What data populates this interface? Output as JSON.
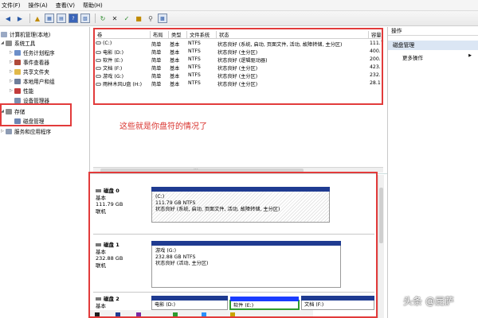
{
  "menu": {
    "file": "文件(F)",
    "action": "操作(A)",
    "view": "查看(V)",
    "help": "帮助(H)"
  },
  "tree": {
    "root": "计算机管理(本地)",
    "system_tools": "系统工具",
    "task_scheduler": "任务计划程序",
    "event_viewer": "事件查看器",
    "shared_folders": "共享文件夹",
    "local_users": "本地用户和组",
    "performance": "性能",
    "device_manager": "设备管理器",
    "storage": "存储",
    "disk_management": "磁盘管理",
    "services": "服务和应用程序"
  },
  "table": {
    "headers": {
      "volume": "卷",
      "layout": "布局",
      "type": "类型",
      "fs": "文件系统",
      "status": "状态",
      "capacity": "容量"
    },
    "rows": [
      {
        "volume": "(C:)",
        "layout": "简单",
        "type": "基本",
        "fs": "NTFS",
        "status": "状态良好 (系统, 启动, 页面文件, 活动, 故障转储, 主分区)",
        "capacity": "111.7"
      },
      {
        "volume": "电影 (D:)",
        "layout": "简单",
        "type": "基本",
        "fs": "NTFS",
        "status": "状态良好 (主分区)",
        "capacity": "400."
      },
      {
        "volume": "软件 (E:)",
        "layout": "简单",
        "type": "基本",
        "fs": "NTFS",
        "status": "状态良好 (逻辑驱动器)",
        "capacity": "200."
      },
      {
        "volume": "文档 (F:)",
        "layout": "简单",
        "type": "基本",
        "fs": "NTFS",
        "status": "状态良好 (主分区)",
        "capacity": "423."
      },
      {
        "volume": "游戏 (G:)",
        "layout": "简单",
        "type": "基本",
        "fs": "NTFS",
        "status": "状态良好 (主分区)",
        "capacity": "232."
      },
      {
        "volume": "雨林木风U盘 (H:)",
        "layout": "简单",
        "type": "基本",
        "fs": "NTFS",
        "status": "状态良好 (主分区)",
        "capacity": "28.1"
      }
    ]
  },
  "annotation": "这些就是你盘符的情况了",
  "scroll_glyph": "...",
  "disks": [
    {
      "name": "磁盘 0",
      "type": "基本",
      "size": "111.79 GB",
      "state": "联机",
      "partitions": [
        {
          "label": "(C:)",
          "detail": "111.79 GB NTFS",
          "status": "状态良好 (系统, 启动, 页面文件, 活动, 故障转储, 主分区)"
        }
      ]
    },
    {
      "name": "磁盘 1",
      "type": "基本",
      "size": "232.88 GB",
      "state": "联机",
      "partitions": [
        {
          "label": "游戏  (G:)",
          "detail": "232.88 GB NTFS",
          "status": "状态良好 (活动, 主分区)"
        }
      ]
    },
    {
      "name": "磁盘 2",
      "type": "基本",
      "partitions": [
        {
          "label": "电影  (D:)"
        },
        {
          "label": "软件  (E:)"
        },
        {
          "label": "文档  (F:)"
        }
      ]
    }
  ],
  "actions": {
    "title": "操作",
    "section": "磁盘管理",
    "more": "更多操作"
  },
  "watermark": "头条 @屁萨",
  "colors": {
    "highlight_border": "#e23b3b",
    "partition_bar": "#1f3b91",
    "selected_bar": "#1a3cff",
    "logical_bar": "#2e9b2e",
    "annotation": "#d9332e"
  },
  "legend_colors": [
    "#1f1f1f",
    "#1f3b91",
    "#7a2aa0",
    "#2e9b2e",
    "#2b8fff",
    "#c9a400"
  ]
}
